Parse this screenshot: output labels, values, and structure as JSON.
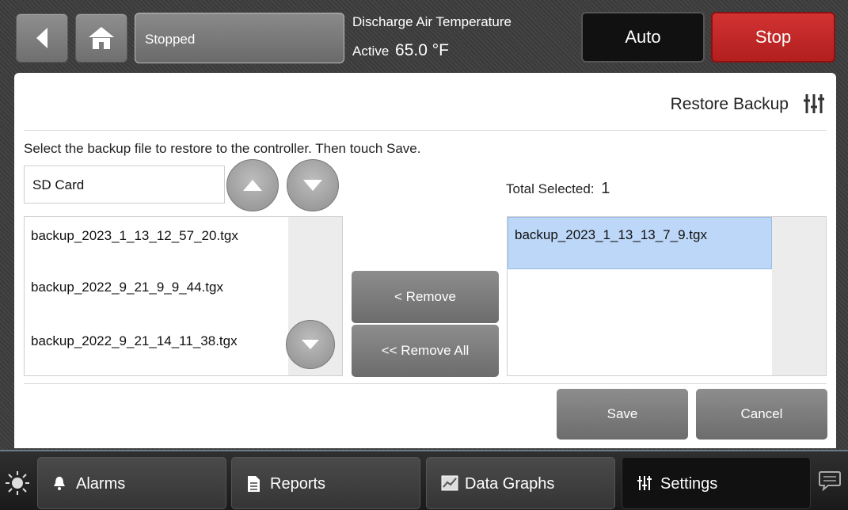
{
  "header": {
    "status": "Stopped",
    "sensor_label": "Discharge Air Temperature",
    "active_prefix": "Active",
    "active_value": "65.0 °F",
    "auto_label": "Auto",
    "stop_label": "Stop",
    "stop_color": "#c62828"
  },
  "page": {
    "title": "Restore Backup",
    "instructions": "Select the backup file to restore to the controller. Then touch Save.",
    "source": "SD Card",
    "total_label": "Total Selected:",
    "total_value": "1"
  },
  "available_files": [
    "backup_2023_1_13_12_57_20.tgx",
    "backup_2022_9_21_9_9_44.tgx",
    "backup_2022_9_21_14_11_38.tgx"
  ],
  "selected_files": [
    "backup_2023_1_13_13_7_9.tgx"
  ],
  "actions": {
    "remove": "< Remove",
    "remove_all": "<< Remove All",
    "save": "Save",
    "cancel": "Cancel"
  },
  "nav": {
    "alarms": "Alarms",
    "reports": "Reports",
    "data_graphs": "Data Graphs",
    "settings": "Settings"
  },
  "colors": {
    "selection": "#bcd7f7"
  }
}
